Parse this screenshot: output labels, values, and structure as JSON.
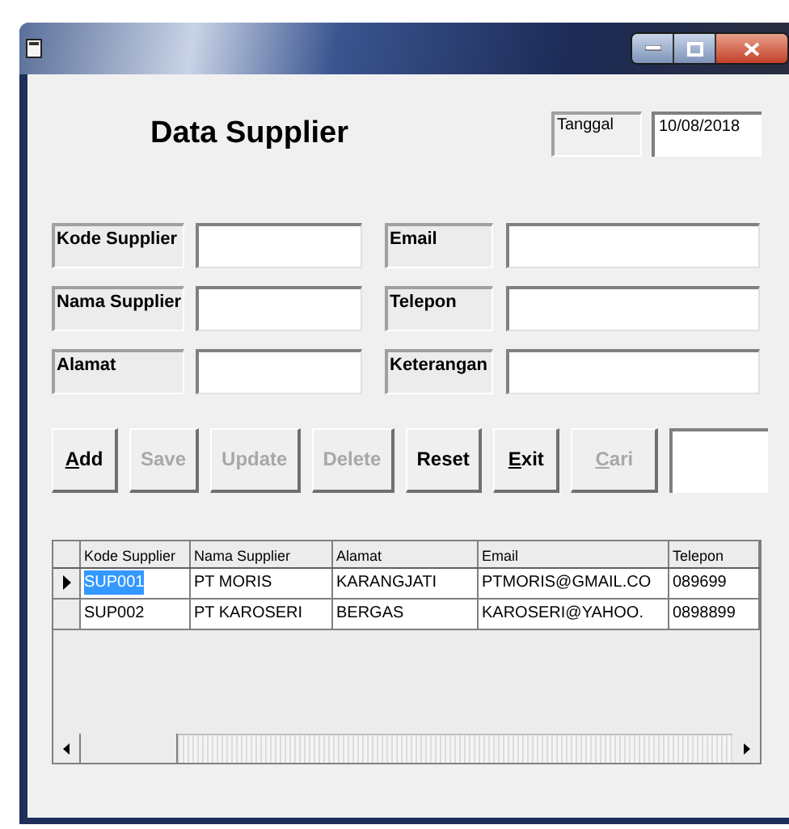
{
  "form": {
    "title": "Data Supplier",
    "date_label": "Tanggal",
    "date_value": "10/08/2018"
  },
  "fields_left": [
    {
      "label": "Kode Supplier"
    },
    {
      "label": "Nama Supplier"
    },
    {
      "label": "Alamat"
    }
  ],
  "fields_right": [
    {
      "label": "Email"
    },
    {
      "label": "Telepon"
    },
    {
      "label": "Keterangan"
    }
  ],
  "buttons": [
    {
      "label": "Add",
      "disabled": false,
      "mnemonic": true
    },
    {
      "label": "Save",
      "disabled": true,
      "mnemonic": false
    },
    {
      "label": "Update",
      "disabled": true,
      "mnemonic": false
    },
    {
      "label": "Delete",
      "disabled": true,
      "mnemonic": false
    },
    {
      "label": "Reset",
      "disabled": false,
      "mnemonic": false
    },
    {
      "label": "Exit",
      "disabled": false,
      "mnemonic": true
    },
    {
      "label": "Cari",
      "disabled": true,
      "mnemonic": true
    }
  ],
  "table": {
    "columns": [
      "Kode Supplier",
      "Nama Supplier",
      "Alamat",
      "Email",
      "Telepon"
    ],
    "rows": [
      {
        "selected": true,
        "cells": [
          "SUP001",
          "PT MORIS",
          "KARANGJATI",
          "PTMORIS@GMAIL.CO",
          "089699"
        ]
      },
      {
        "selected": false,
        "cells": [
          "SUP002",
          "PT KAROSERI",
          "BERGAS",
          "KAROSERI@YAHOO.",
          "0898899"
        ]
      }
    ]
  }
}
